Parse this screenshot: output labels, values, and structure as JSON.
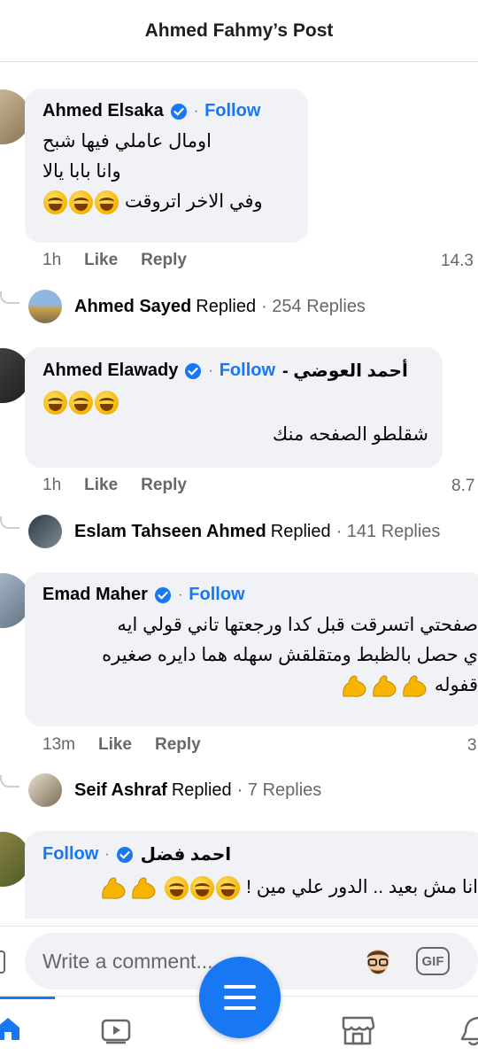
{
  "header": {
    "title": "Ahmed Fahmy’s Post"
  },
  "comments": [
    {
      "name": "Ahmed Elsaka",
      "follow": "Follow",
      "lines": [
        "اومال عاملي فيها شبح",
        "وانا بابا يالا",
        "وفي الاخر اتروقت"
      ],
      "time": "1h",
      "like": "Like",
      "reply": "Reply",
      "reactions": "14.3"
    },
    {
      "name": "Ahmed Elawady",
      "follow": "Follow",
      "alt_name": "أحمد العوضي -",
      "lines": [
        "شقلطو الصفحه منك"
      ],
      "time": "1h",
      "like": "Like",
      "reply": "Reply",
      "reactions": "8.7"
    },
    {
      "name": "Emad Maher",
      "follow": "Follow",
      "lines": [
        "صفحتي اتسرقت قبل كدا ورجعتها تاني قولي ايه",
        "ي حصل بالظبط ومتقلقش سهله هما دايره صغيره",
        "قفوله"
      ],
      "time": "13m",
      "like": "Like",
      "reply": "Reply",
      "reactions": "3"
    },
    {
      "name": "احمد فضل",
      "follow": "Follow",
      "lines": [
        "انا مش بعيد .. الدور علي مين !"
      ]
    }
  ],
  "replies_summaries": [
    {
      "name": "Ahmed Sayed",
      "word": "Replied",
      "count": "· 254 Replies"
    },
    {
      "name": "Eslam Tahseen Ahmed",
      "word": "Replied",
      "count": "· 141 Replies"
    },
    {
      "name": "Seif Ashraf",
      "word": "Replied",
      "count": "· 7 Replies"
    }
  ],
  "composer": {
    "placeholder": "Write a comment...",
    "gif": "GIF"
  },
  "icons": {
    "verified": "verified-badge-icon",
    "emoji": "face-with-tears-of-joy-icon",
    "muscle": "flexed-biceps-icon",
    "home": "home-icon",
    "video": "video-icon",
    "menu": "menu-icon",
    "marketplace": "marketplace-icon",
    "notifications": "bell-icon"
  },
  "colors": {
    "accent": "#1877f2",
    "bubble": "#f0f2f5",
    "secondary_text": "#65676b"
  }
}
